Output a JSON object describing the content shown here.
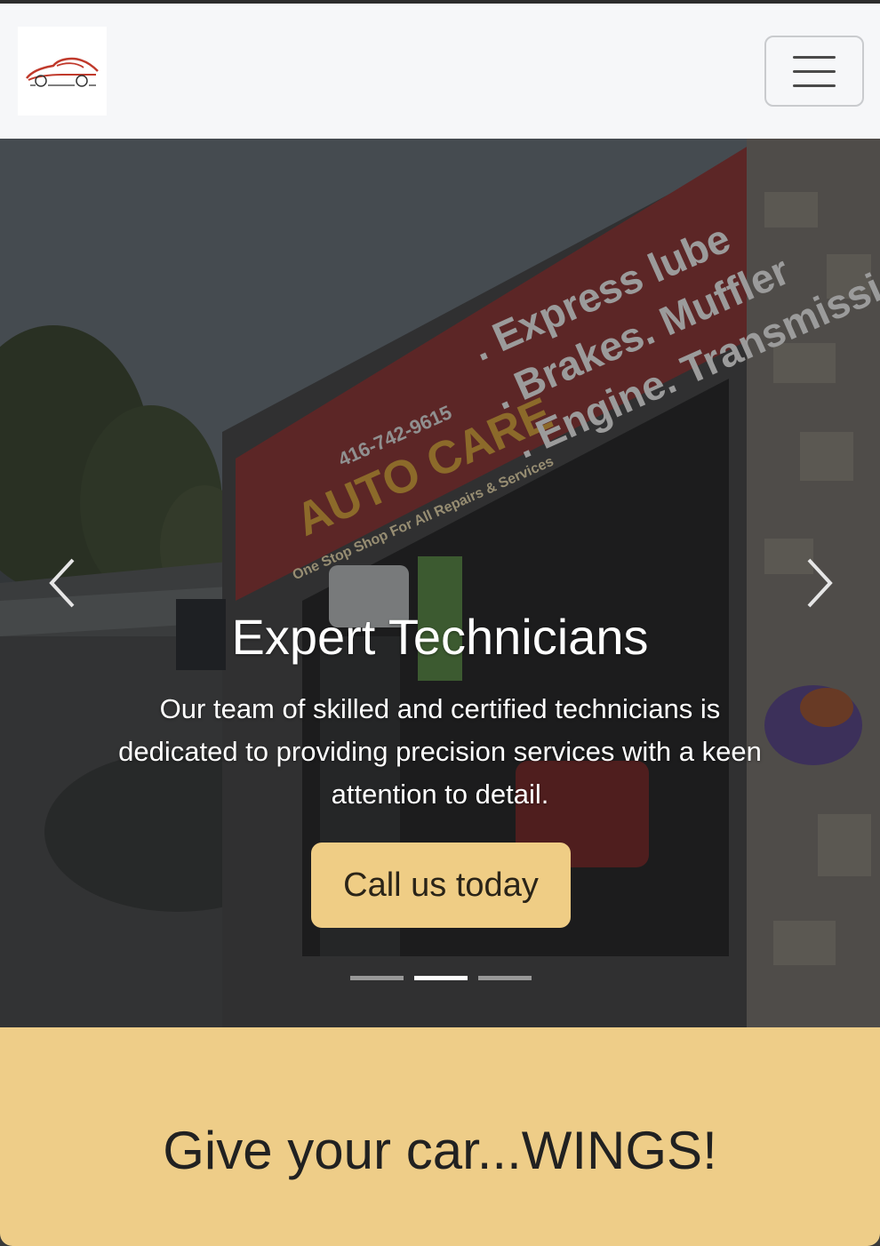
{
  "navbar": {
    "logo_icon": "sports-car-logo",
    "toggle_icon": "hamburger-menu-icon"
  },
  "hero": {
    "slide_title": "Expert Technicians",
    "slide_text": "Our team of skilled and certified technicians is dedicated to providing precision services with a keen attention to detail.",
    "cta_label": "Call us today",
    "prev_icon": "chevron-left-icon",
    "next_icon": "chevron-right-icon",
    "indicators": [
      {
        "active": false
      },
      {
        "active": true
      },
      {
        "active": false
      }
    ],
    "shop_sign": {
      "brand": "AUTO CARE",
      "phone": "416-742-9615",
      "tagline": "One Stop Shop For All Repairs & Services",
      "services": [
        ". Express lube",
        ". Brakes. Muffler",
        ". Engine. Transmission"
      ]
    }
  },
  "banner": {
    "heading": "Give your car...WINGS!"
  },
  "colors": {
    "accent": "#efcd85",
    "navbar_bg": "#f6f7f9",
    "text_dark": "#212121"
  }
}
